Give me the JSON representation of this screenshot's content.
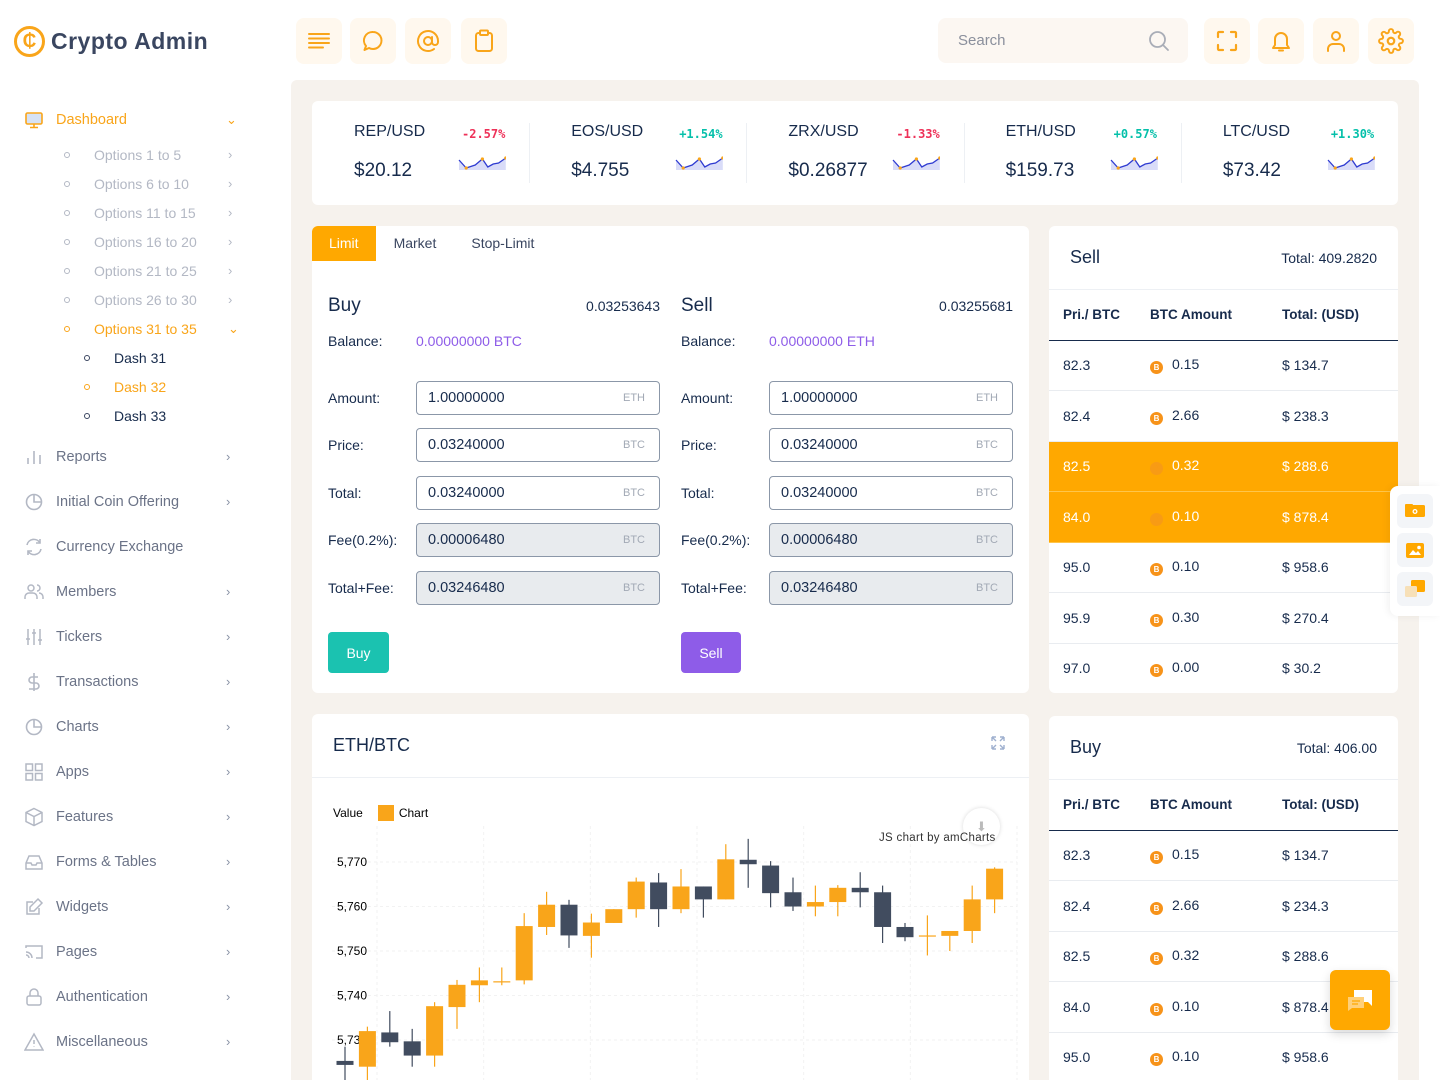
{
  "brand": {
    "name": "Crypto Admin",
    "logo_glyph": "₵"
  },
  "sidebar": {
    "dashboard": {
      "label": "Dashboard",
      "icon": "monitor-icon"
    },
    "options": [
      {
        "label": "Options 1 to 5"
      },
      {
        "label": "Options 6 to 10"
      },
      {
        "label": "Options 11 to 15"
      },
      {
        "label": "Options 16 to 20"
      },
      {
        "label": "Options 21 to 25"
      },
      {
        "label": "Options 26 to 30"
      },
      {
        "label": "Options 31 to 35",
        "active": true
      }
    ],
    "dash_items": [
      {
        "label": "Dash 31"
      },
      {
        "label": "Dash 32",
        "active": true
      },
      {
        "label": "Dash 33"
      }
    ],
    "items": [
      {
        "label": "Reports",
        "icon": "bar-chart-icon",
        "chevron": true
      },
      {
        "label": "Initial Coin Offering",
        "icon": "pie-chart-icon",
        "chevron": true
      },
      {
        "label": "Currency Exchange",
        "icon": "refresh-icon",
        "chevron": false
      },
      {
        "label": "Members",
        "icon": "users-icon",
        "chevron": true
      },
      {
        "label": "Tickers",
        "icon": "sliders-icon",
        "chevron": true
      },
      {
        "label": "Transactions",
        "icon": "dollar-icon",
        "chevron": true
      },
      {
        "label": "Charts",
        "icon": "pie-chart-icon",
        "chevron": true
      },
      {
        "label": "Apps",
        "icon": "grid-icon",
        "chevron": true
      },
      {
        "label": "Features",
        "icon": "box-icon",
        "chevron": true
      },
      {
        "label": "Forms & Tables",
        "icon": "inbox-icon",
        "chevron": true
      },
      {
        "label": "Widgets",
        "icon": "edit-icon",
        "chevron": true
      },
      {
        "label": "Pages",
        "icon": "cast-icon",
        "chevron": true
      },
      {
        "label": "Authentication",
        "icon": "lock-icon",
        "chevron": true
      },
      {
        "label": "Miscellaneous",
        "icon": "alert-triangle-icon",
        "chevron": true
      }
    ]
  },
  "topbar": {
    "left_buttons": [
      "menu-icon",
      "chat-bubble-icon",
      "at-sign-icon",
      "clipboard-icon"
    ],
    "search": {
      "placeholder": "Search"
    },
    "right_buttons": [
      "fullscreen-icon",
      "bell-icon",
      "user-icon",
      "settings-icon"
    ]
  },
  "tickers": [
    {
      "pair": "REP/USD",
      "change": "-2.57%",
      "direction": "neg",
      "price": "$20.12"
    },
    {
      "pair": "EOS/USD",
      "change": "+1.54%",
      "direction": "pos",
      "price": "$4.755"
    },
    {
      "pair": "ZRX/USD",
      "change": "-1.33%",
      "direction": "neg",
      "price": "$0.26877"
    },
    {
      "pair": "ETH/USD",
      "change": "+0.57%",
      "direction": "pos",
      "price": "$159.73"
    },
    {
      "pair": "LTC/USD",
      "change": "+1.30%",
      "direction": "pos",
      "price": "$73.42"
    }
  ],
  "trade": {
    "tabs": [
      {
        "label": "Limit",
        "active": true
      },
      {
        "label": "Market"
      },
      {
        "label": "Stop-Limit"
      }
    ],
    "buy": {
      "title": "Buy",
      "rate": "0.03253643",
      "balance_label": "Balance:",
      "balance": "0.00000000 BTC",
      "fields": [
        {
          "label": "Amount:",
          "value": "1.00000000",
          "unit": "ETH",
          "readonly": false
        },
        {
          "label": "Price:",
          "value": "0.03240000",
          "unit": "BTC",
          "readonly": false
        },
        {
          "label": "Total:",
          "value": "0.03240000",
          "unit": "BTC",
          "readonly": false
        },
        {
          "label": "Fee(0.2%):",
          "value": "0.00006480",
          "unit": "BTC",
          "readonly": true
        },
        {
          "label": "Total+Fee:",
          "value": "0.03246480",
          "unit": "BTC",
          "readonly": true
        }
      ],
      "button": "Buy",
      "button_color": "#1bc2b0"
    },
    "sell": {
      "title": "Sell",
      "rate": "0.03255681",
      "balance_label": "Balance:",
      "balance": "0.00000000 ETH",
      "fields": [
        {
          "label": "Amount:",
          "value": "1.00000000",
          "unit": "ETH",
          "readonly": false
        },
        {
          "label": "Price:",
          "value": "0.03240000",
          "unit": "BTC",
          "readonly": false
        },
        {
          "label": "Total:",
          "value": "0.03240000",
          "unit": "BTC",
          "readonly": false
        },
        {
          "label": "Fee(0.2%):",
          "value": "0.00006480",
          "unit": "BTC",
          "readonly": true
        },
        {
          "label": "Total+Fee:",
          "value": "0.03246480",
          "unit": "BTC",
          "readonly": true
        }
      ],
      "button": "Sell",
      "button_color": "#8e5ce8"
    }
  },
  "sell_book": {
    "title": "Sell",
    "total": "Total: 409.2820",
    "headers": [
      "Pri./ BTC",
      "BTC Amount",
      "Total: (USD)"
    ],
    "rows": [
      {
        "price": "82.3",
        "amount": "0.15",
        "total": "$ 134.7",
        "highlight": false
      },
      {
        "price": "82.4",
        "amount": "2.66",
        "total": "$ 238.3",
        "highlight": false
      },
      {
        "price": "82.5",
        "amount": "0.32",
        "total": "$ 288.6",
        "highlight": true
      },
      {
        "price": "84.0",
        "amount": "0.10",
        "total": "$ 878.4",
        "highlight": true
      },
      {
        "price": "95.0",
        "amount": "0.10",
        "total": "$ 958.6",
        "highlight": false
      },
      {
        "price": "95.9",
        "amount": "0.30",
        "total": "$ 270.4",
        "highlight": false
      },
      {
        "price": "97.0",
        "amount": "0.00",
        "total": "$ 30.2",
        "highlight": false
      }
    ]
  },
  "buy_book": {
    "title": "Buy",
    "total": "Total: 406.00",
    "headers": [
      "Pri./ BTC",
      "BTC Amount",
      "Total: (USD)"
    ],
    "rows": [
      {
        "price": "82.3",
        "amount": "0.15",
        "total": "$ 134.7"
      },
      {
        "price": "82.4",
        "amount": "2.66",
        "total": "$ 234.3"
      },
      {
        "price": "82.5",
        "amount": "0.32",
        "total": "$ 288.6"
      },
      {
        "price": "84.0",
        "amount": "0.10",
        "total": "$ 878.4"
      },
      {
        "price": "95.0",
        "amount": "0.10",
        "total": "$ 958.6"
      }
    ]
  },
  "chart_card": {
    "title": "ETH/BTC",
    "legend_value_label": "Value",
    "legend_series": "Chart",
    "credit": "JS chart by amCharts"
  },
  "colors": {
    "accent": "#ffa800",
    "up": "#f9a51a",
    "down": "#414c5f",
    "neg": "#ee3158",
    "pos": "#05c0aa"
  },
  "chart_data": {
    "type": "candlestick",
    "title": "ETH/BTC",
    "legend": [
      "Chart"
    ],
    "ylabel": "Value",
    "y_ticks": [
      5730,
      5740,
      5750,
      5760,
      5770
    ],
    "y_tick_labels": [
      "5,730",
      "5,740",
      "5,750",
      "5,760",
      "5,770"
    ],
    "ylim": [
      5717,
      5777
    ],
    "grid": true,
    "candles": [
      {
        "open": 5725.3,
        "close": 5724.4,
        "high": 5728.5,
        "low": 5721
      },
      {
        "open": 5724.0,
        "close": 5732.0,
        "high": 5733.0,
        "low": 5721
      },
      {
        "open": 5731.7,
        "close": 5729.5,
        "high": 5736.5,
        "low": 5728.5
      },
      {
        "open": 5729.7,
        "close": 5726.5,
        "high": 5732.5,
        "low": 5724.0
      },
      {
        "open": 5726.5,
        "close": 5737.6,
        "high": 5738.5,
        "low": 5724.0
      },
      {
        "open": 5737.4,
        "close": 5742.4,
        "high": 5743.5,
        "low": 5732.5
      },
      {
        "open": 5742.3,
        "close": 5743.4,
        "high": 5746.3,
        "low": 5738.5
      },
      {
        "open": 5743.0,
        "close": 5743.2,
        "high": 5746.3,
        "low": 5742.3
      },
      {
        "open": 5743.4,
        "close": 5755.6,
        "high": 5758.5,
        "low": 5742.5
      },
      {
        "open": 5755.4,
        "close": 5760.4,
        "high": 5763.3,
        "low": 5753.6
      },
      {
        "open": 5760.4,
        "close": 5753.5,
        "high": 5761.5,
        "low": 5750.7
      },
      {
        "open": 5753.4,
        "close": 5756.4,
        "high": 5758.4,
        "low": 5748.5
      },
      {
        "open": 5756.3,
        "close": 5759.4,
        "high": 5759.4,
        "low": 5756.3
      },
      {
        "open": 5759.4,
        "close": 5765.6,
        "high": 5766.5,
        "low": 5757.5
      },
      {
        "open": 5765.4,
        "close": 5759.4,
        "high": 5767.5,
        "low": 5755.4
      },
      {
        "open": 5759.4,
        "close": 5764.5,
        "high": 5768.4,
        "low": 5758.5
      },
      {
        "open": 5764.5,
        "close": 5761.6,
        "high": 5764.5,
        "low": 5757.5
      },
      {
        "open": 5761.6,
        "close": 5770.6,
        "high": 5774.0,
        "low": 5761.6
      },
      {
        "open": 5770.5,
        "close": 5769.5,
        "high": 5775.2,
        "low": 5764.2
      },
      {
        "open": 5769.2,
        "close": 5763.0,
        "high": 5770.2,
        "low": 5759.8
      },
      {
        "open": 5763.2,
        "close": 5760.0,
        "high": 5766.5,
        "low": 5759.0
      },
      {
        "open": 5760.0,
        "close": 5761.0,
        "high": 5764.7,
        "low": 5757.8
      },
      {
        "open": 5761.0,
        "close": 5764.2,
        "high": 5764.8,
        "low": 5757.8
      },
      {
        "open": 5764.2,
        "close": 5763.2,
        "high": 5767.7,
        "low": 5759.8
      },
      {
        "open": 5763.2,
        "close": 5755.4,
        "high": 5764.7,
        "low": 5751.8
      },
      {
        "open": 5755.4,
        "close": 5753.1,
        "high": 5756.3,
        "low": 5752.2
      },
      {
        "open": 5753.3,
        "close": 5753.5,
        "high": 5758.0,
        "low": 5749.0
      },
      {
        "open": 5753.4,
        "close": 5754.5,
        "high": 5754.5,
        "low": 5750.0
      },
      {
        "open": 5754.5,
        "close": 5761.6,
        "high": 5764.7,
        "low": 5751.8
      },
      {
        "open": 5761.6,
        "close": 5768.5,
        "high": 5768.8,
        "low": 5758.5
      }
    ]
  }
}
